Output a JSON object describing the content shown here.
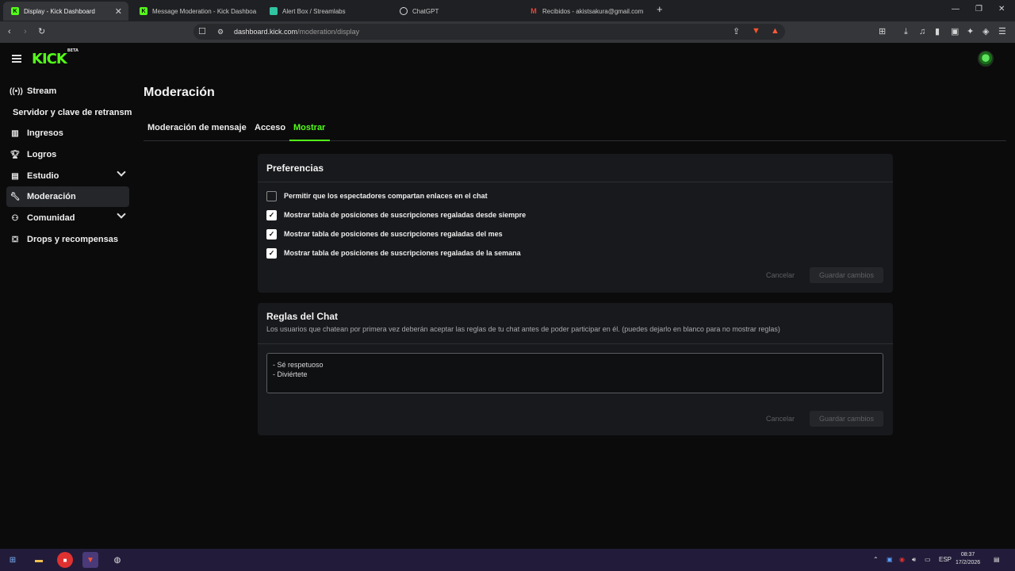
{
  "browser": {
    "tabs": [
      {
        "title": "Display - Kick Dashboard",
        "active": true
      },
      {
        "title": "Message Moderation - Kick Dashboa",
        "active": false
      },
      {
        "title": "Alert Box / Streamlabs",
        "active": false
      },
      {
        "title": "ChatGPT",
        "active": false
      },
      {
        "title": "Recibidos - akistsakura@gmail.com",
        "active": false
      }
    ],
    "new_tab_label": "+",
    "url_domain": "dashboard.kick.com",
    "url_path": "/moderation/display"
  },
  "header": {
    "logo_text": "KICK",
    "logo_badge": "BETA"
  },
  "sidebar": {
    "items": [
      {
        "label": "Stream",
        "icon": "broadcast-icon"
      },
      {
        "label": "Servidor y clave de retransm",
        "icon": ""
      },
      {
        "label": "Ingresos",
        "icon": "chart-icon"
      },
      {
        "label": "Logros",
        "icon": "trophy-icon"
      },
      {
        "label": "Estudio",
        "icon": "studio-icon"
      },
      {
        "label": "Moderación",
        "icon": "wrench-icon"
      },
      {
        "label": "Comunidad",
        "icon": "community-icon"
      },
      {
        "label": "Drops y recompensas",
        "icon": "gift-icon"
      }
    ]
  },
  "main": {
    "title": "Moderación",
    "tabs": [
      "Moderación de mensaje",
      "Acceso",
      "Mostrar"
    ],
    "active_tab": "Mostrar",
    "preferences": {
      "title": "Preferencias",
      "options": [
        {
          "label": "Permitir que los espectadores compartan enlaces en el chat",
          "checked": false
        },
        {
          "label": "Mostrar tabla de posiciones de suscripciones regaladas desde siempre",
          "checked": true
        },
        {
          "label": "Mostrar tabla de posiciones de suscripciones regaladas del mes",
          "checked": true
        },
        {
          "label": "Mostrar tabla de posiciones de suscripciones regaladas de la semana",
          "checked": true
        }
      ],
      "cancel_label": "Cancelar",
      "save_label": "Guardar cambios"
    },
    "chat_rules": {
      "title": "Reglas del Chat",
      "description": "Los usuarios que chatean por primera vez deberán aceptar las reglas de tu chat antes de poder participar en él. (puedes dejarlo en blanco para no mostrar reglas)",
      "value": "- Sé respetuoso\n- Diviértete",
      "cancel_label": "Cancelar",
      "save_label": "Guardar cambios"
    }
  },
  "taskbar": {
    "language": "ESP",
    "time": "08:37",
    "date": "17/2/2026"
  },
  "colors": {
    "accent": "#53fc18",
    "background": "#0b0b0c",
    "card": "#18191c"
  }
}
